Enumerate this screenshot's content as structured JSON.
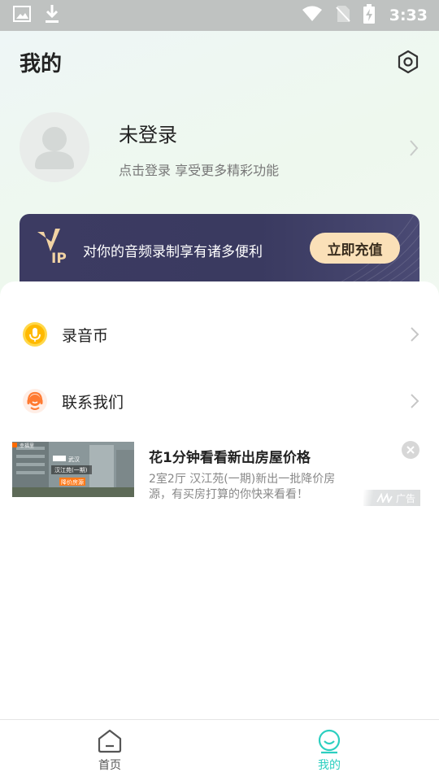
{
  "status_bar": {
    "time": "3:33",
    "left_icons": [
      "image-icon",
      "download-icon"
    ],
    "right_icons": [
      "wifi-icon",
      "no-sim-icon",
      "battery-charging-icon"
    ]
  },
  "header": {
    "title": "我的",
    "settings_icon": "settings-hexagon-icon"
  },
  "profile": {
    "name": "未登录",
    "subtitle": "点击登录 享受更多精彩功能"
  },
  "vip": {
    "logo_text": "VIP",
    "text": "对你的音频录制享有诸多便利",
    "button_label": "立即充值",
    "colors": {
      "banner": "#3c3b62",
      "button": "#fae0b8",
      "logo": "#f1d3a4"
    }
  },
  "menu": [
    {
      "label": "录音币",
      "icon": "microphone-coin-icon"
    },
    {
      "label": "联系我们",
      "icon": "customer-service-icon"
    }
  ],
  "ad": {
    "title": "花1分钟看看新出房屋价格",
    "description": "2室2厅 汉江苑(一期)新出一批降价房源，有买房打算的你快来看看！",
    "badge": "广告",
    "image_brand": "幸福里",
    "image_city": "武汉",
    "image_estate": "汉江苑(一期)",
    "image_tag": "降价房源"
  },
  "bottom_nav": {
    "items": [
      {
        "label": "首页",
        "icon": "home-icon",
        "active": false
      },
      {
        "label": "我的",
        "icon": "smile-icon",
        "active": true
      }
    ],
    "colors": {
      "active": "#2ccfc0",
      "inactive": "#555555"
    }
  }
}
